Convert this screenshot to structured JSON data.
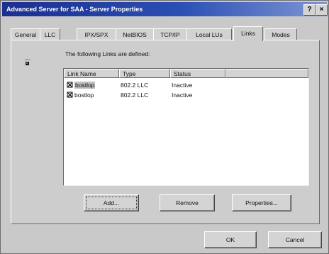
{
  "window": {
    "title": "Advanced Server for SAA - Server Properties",
    "help_label": "?",
    "close_label": "×"
  },
  "tabs": [
    {
      "label": "General",
      "active": false
    },
    {
      "label": "LLC",
      "active": false
    },
    {
      "label": "IPX/SPX",
      "active": false
    },
    {
      "label": "NetBIOS",
      "active": false
    },
    {
      "label": "TCP/IP",
      "active": false
    },
    {
      "label": "Local LUs",
      "active": false
    },
    {
      "label": "Links",
      "active": true
    },
    {
      "label": "Modes",
      "active": false
    }
  ],
  "links_page": {
    "heading": "The following Links are defined:",
    "icon": "link-icon",
    "columns": [
      "Link Name",
      "Type",
      "Status"
    ],
    "rows": [
      {
        "name": "bostlop",
        "type": "802.2 LLC",
        "status": "Inactive",
        "selected": true
      },
      {
        "name": "bostlop",
        "type": "802.2 LLC",
        "status": "Inactive",
        "selected": false
      }
    ],
    "add_label": "Add...",
    "remove_label": "Remove",
    "properties_label": "Properties..."
  },
  "footer": {
    "ok_label": "OK",
    "cancel_label": "Cancel"
  }
}
